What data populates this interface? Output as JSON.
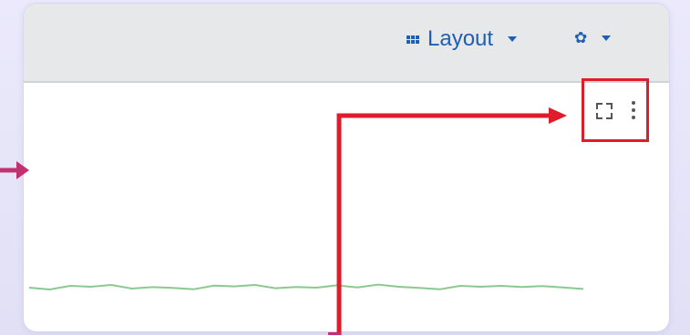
{
  "toolbar": {
    "layout_label": "Layout",
    "layout_icon": "grid-icon",
    "settings_icon": "gear-icon"
  },
  "panel": {
    "tools": [
      "expand-icon",
      "kebab-icon"
    ]
  },
  "annotations": {
    "highlight_color": "#e01b2a",
    "arrow_color_red": "#e01b2a",
    "arrow_color_magenta": "#c2306f"
  },
  "sparkline": {
    "color": "#8ac98f",
    "values": [
      0.45,
      0.35,
      0.55,
      0.5,
      0.6,
      0.4,
      0.48,
      0.44,
      0.36,
      0.56,
      0.52,
      0.6,
      0.42,
      0.49,
      0.45,
      0.58,
      0.46,
      0.62,
      0.5,
      0.44,
      0.36,
      0.55,
      0.5,
      0.55,
      0.49,
      0.54,
      0.46,
      0.38
    ]
  }
}
